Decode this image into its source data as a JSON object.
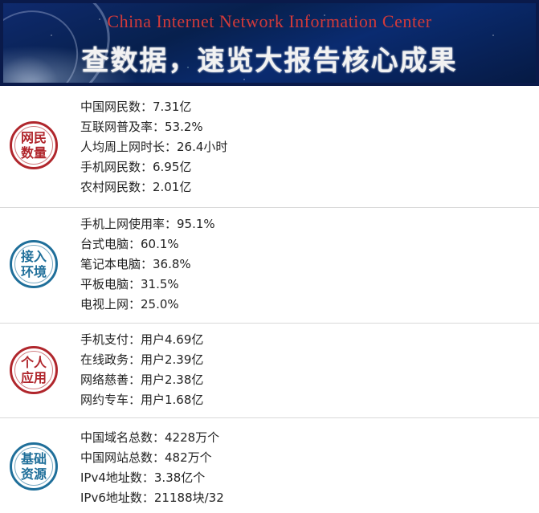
{
  "banner": {
    "english_title": "China Internet Network Information Center",
    "chinese_title": "查数据，速览大报告核心成果"
  },
  "sections": [
    {
      "badge": [
        "网民",
        "数量"
      ],
      "items": [
        "中国网民数：7.31亿",
        "互联网普及率：53.2%",
        "人均周上网时长：26.4小时",
        "手机网民数：6.95亿",
        "农村网民数：2.01亿"
      ]
    },
    {
      "badge": [
        "接入",
        "环境"
      ],
      "items": [
        "手机上网使用率：95.1%",
        "台式电脑：60.1%",
        "笔记本电脑：36.8%",
        "平板电脑：31.5%",
        "电视上网：25.0%"
      ]
    },
    {
      "badge": [
        "个人",
        "应用"
      ],
      "items": [
        "手机支付：用户4.69亿",
        "在线政务：用户2.39亿",
        "网络慈善：用户2.38亿",
        "网约专车：用户1.68亿"
      ]
    },
    {
      "badge": [
        "基础",
        "资源"
      ],
      "items": [
        "中国域名总数：4228万个",
        "中国网站总数：482万个",
        "IPv4地址数：3.38亿个",
        "IPv6地址数：21188块/32"
      ]
    }
  ],
  "colors": {
    "red_badge": "#b0262c",
    "blue_badge": "#1f6f9a",
    "banner_bg": "#0a2b70"
  }
}
